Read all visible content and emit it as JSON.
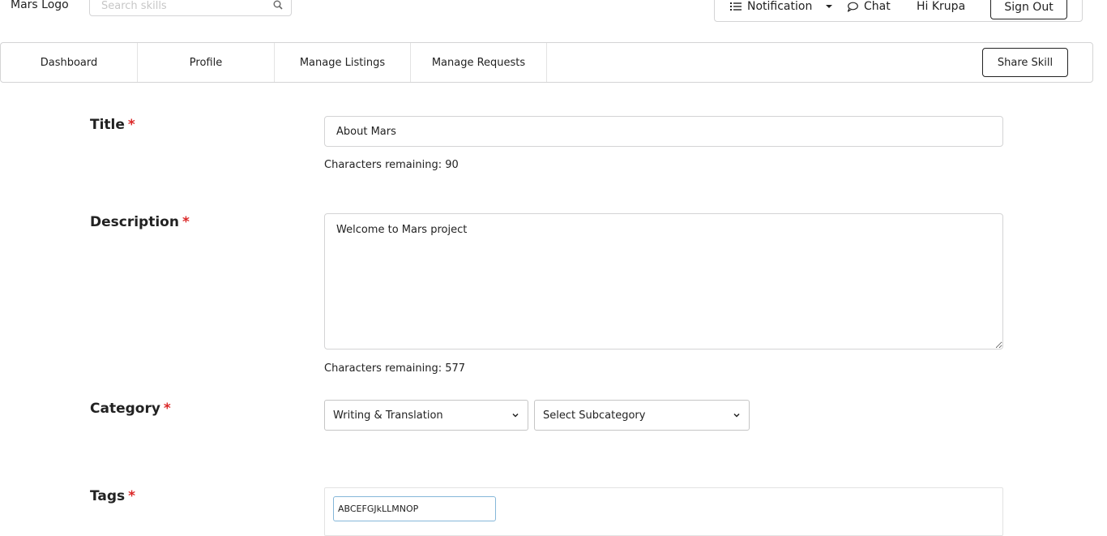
{
  "header": {
    "logo_text": "Mars Logo",
    "search": {
      "placeholder": "Search skills",
      "value": ""
    },
    "notification_label": "Notification",
    "chat_label": "Chat",
    "greeting": "Hi Krupa",
    "sign_out_label": "Sign Out"
  },
  "nav": {
    "items": [
      {
        "label": "Dashboard"
      },
      {
        "label": "Profile"
      },
      {
        "label": "Manage Listings"
      },
      {
        "label": "Manage Requests"
      }
    ],
    "share_skill_label": "Share Skill"
  },
  "form": {
    "required_marker": "*",
    "title": {
      "label": "Title",
      "value": "About Mars",
      "chars_remaining": "Characters remaining: 90"
    },
    "description": {
      "label": "Description",
      "value": "Welcome to Mars project",
      "chars_remaining": "Characters remaining: 577"
    },
    "category": {
      "label": "Category",
      "selected": "Writing & Translation",
      "subcategory_selected": "Select Subcategory"
    },
    "tags": {
      "label": "Tags",
      "input_value": "ABCEFGJkLLMNOP"
    }
  },
  "icons": {
    "search": "search-icon",
    "notification": "list-icon",
    "dropdown": "caret-down-icon",
    "chat": "chat-bubble-icon",
    "select": "chevron-down-icon"
  }
}
